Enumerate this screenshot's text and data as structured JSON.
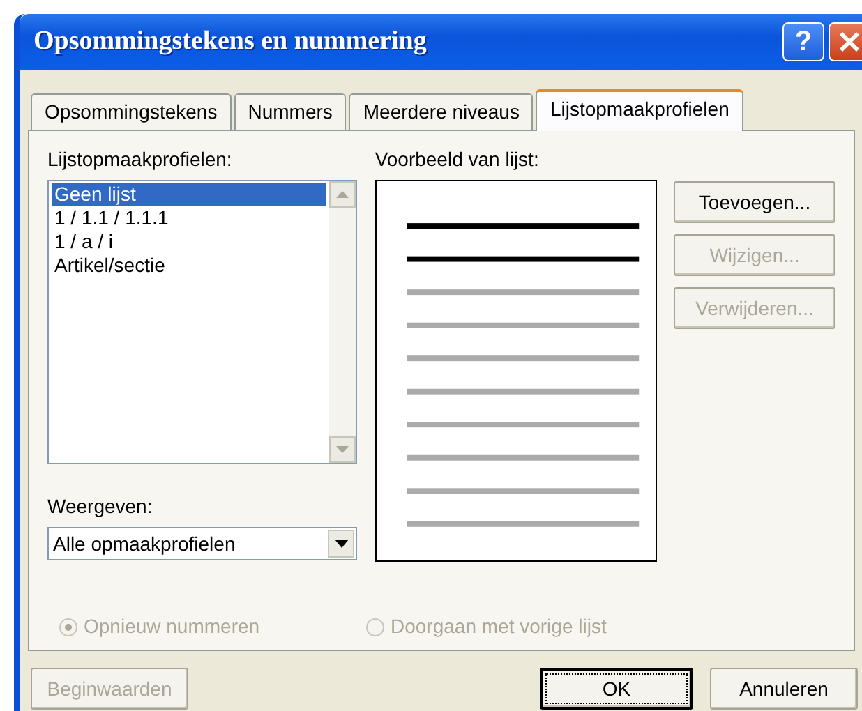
{
  "window": {
    "title": "Opsommingstekens en nummering",
    "help_button": "?"
  },
  "tabs": [
    {
      "label": "Opsommingstekens",
      "selected": false
    },
    {
      "label": "Nummers",
      "selected": false
    },
    {
      "label": "Meerdere niveaus",
      "selected": false
    },
    {
      "label": "Lijstopmaakprofielen",
      "selected": true
    }
  ],
  "styles_list": {
    "label": "Lijstopmaakprofielen:",
    "items": [
      {
        "label": "Geen lijst",
        "selected": true
      },
      {
        "label": "1 / 1.1 / 1.1.1",
        "selected": false
      },
      {
        "label": "1 / a / i",
        "selected": false
      },
      {
        "label": "Artikel/sectie",
        "selected": false
      }
    ]
  },
  "show": {
    "label": "Weergeven:",
    "value": "Alle opmaakprofielen"
  },
  "preview": {
    "label": "Voorbeeld van lijst:"
  },
  "side_buttons": [
    {
      "label": "Toevoegen...",
      "disabled": false
    },
    {
      "label": "Wijzigen...",
      "disabled": true
    },
    {
      "label": "Verwijderen...",
      "disabled": true
    }
  ],
  "numbering": [
    {
      "label": "Opnieuw nummeren",
      "selected": true,
      "disabled": true
    },
    {
      "label": "Doorgaan met vorige lijst",
      "selected": false,
      "disabled": true
    }
  ],
  "footer_buttons": [
    {
      "label": "Beginwaarden",
      "disabled": true,
      "default": false
    },
    {
      "label": "OK",
      "disabled": false,
      "default": true
    },
    {
      "label": "Annuleren",
      "disabled": false,
      "default": false
    }
  ]
}
